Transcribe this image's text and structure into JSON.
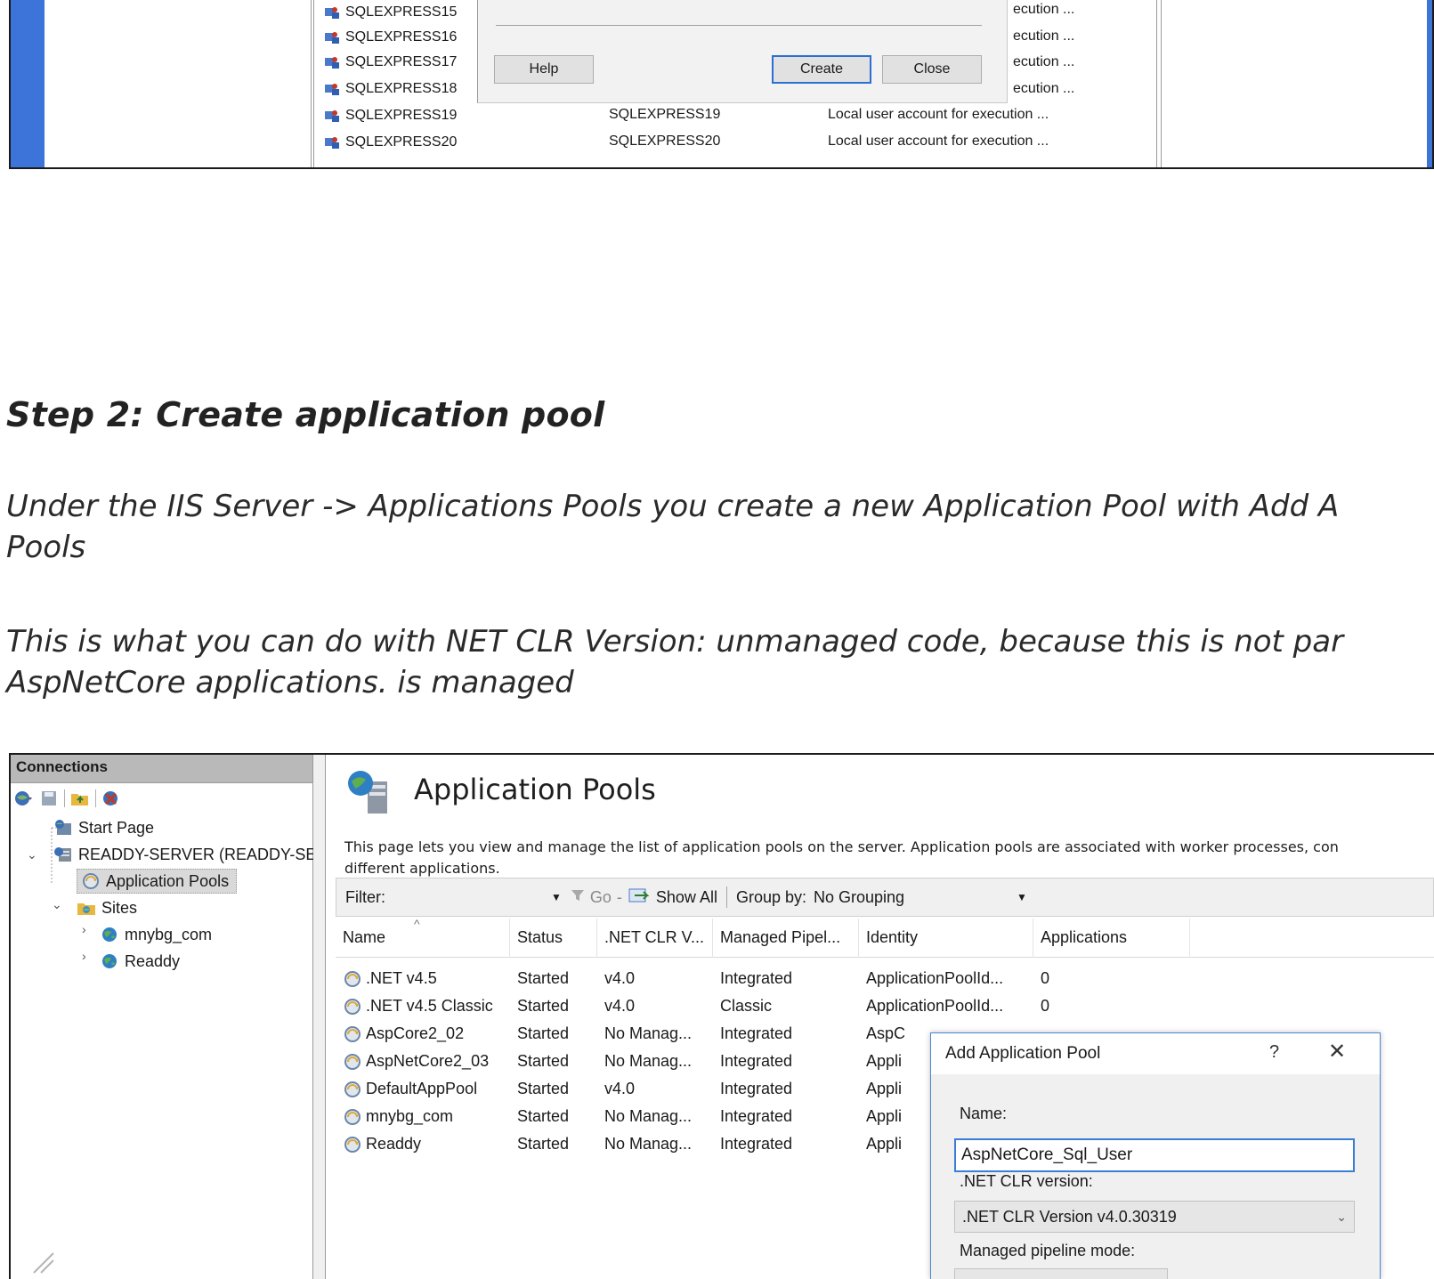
{
  "top_shot": {
    "rows": [
      {
        "name": "SQLEXPRESS15",
        "tail": "ecution ..."
      },
      {
        "name": "SQLEXPRESS16",
        "tail": "ecution ..."
      },
      {
        "name": "SQLEXPRESS17",
        "tail": "ecution ..."
      },
      {
        "name": "SQLEXPRESS18",
        "tail": "ecution ..."
      },
      {
        "name": "SQLEXPRESS19",
        "full_name": "SQLEXPRESS19",
        "description": "Local user account for execution ..."
      },
      {
        "name": "SQLEXPRESS20",
        "full_name": "SQLEXPRESS20",
        "description": "Local user account for execution ..."
      }
    ],
    "buttons": {
      "help": "Help",
      "create": "Create",
      "close": "Close"
    }
  },
  "article": {
    "heading": "Step 2: Create application pool",
    "para1_line1": "Under the IIS Server -> Applications Pools you create a new Application Pool with Add A",
    "para1_line2": "Pools",
    "para2_line1": "This is what you can do with NET CLR Version: unmanaged code, because this is not par",
    "para2_line2": "AspNetCore applications. is managed"
  },
  "iis": {
    "connections": {
      "title": "Connections",
      "tree": {
        "start_page": "Start Page",
        "server": "READDY-SERVER (READDY-SE",
        "app_pools": "Application Pools",
        "sites": "Sites",
        "site1": "mnybg_com",
        "site2": "Readdy"
      }
    },
    "page": {
      "title": "Application Pools",
      "desc_line1": "This page lets you view and manage the list of application pools on the server. Application pools are associated with worker processes, con",
      "desc_line2": "different applications."
    },
    "filter": {
      "label": "Filter:",
      "go": "Go",
      "show_all": "Show All",
      "group_by": "Group by:",
      "group_value": "No Grouping"
    },
    "columns": {
      "name": "Name",
      "status": "Status",
      "clr": ".NET CLR V...",
      "pipeline": "Managed Pipel...",
      "identity": "Identity",
      "applications": "Applications"
    },
    "pools": [
      {
        "name": ".NET v4.5",
        "status": "Started",
        "clr": "v4.0",
        "pipeline": "Integrated",
        "identity": "ApplicationPoolId...",
        "apps": "0"
      },
      {
        "name": ".NET v4.5 Classic",
        "status": "Started",
        "clr": "v4.0",
        "pipeline": "Classic",
        "identity": "ApplicationPoolId...",
        "apps": "0"
      },
      {
        "name": "AspCore2_02",
        "status": "Started",
        "clr": "No Manag...",
        "pipeline": "Integrated",
        "identity": "AspC",
        "apps": ""
      },
      {
        "name": "AspNetCore2_03",
        "status": "Started",
        "clr": "No Manag...",
        "pipeline": "Integrated",
        "identity": "Appli",
        "apps": ""
      },
      {
        "name": "DefaultAppPool",
        "status": "Started",
        "clr": "v4.0",
        "pipeline": "Integrated",
        "identity": "Appli",
        "apps": ""
      },
      {
        "name": "mnybg_com",
        "status": "Started",
        "clr": "No Manag...",
        "pipeline": "Integrated",
        "identity": "Appli",
        "apps": ""
      },
      {
        "name": "Readdy",
        "status": "Started",
        "clr": "No Manag...",
        "pipeline": "Integrated",
        "identity": "Appli",
        "apps": ""
      }
    ]
  },
  "dialog": {
    "title": "Add Application Pool",
    "help": "?",
    "close": "✕",
    "name_label": "Name:",
    "name_value": "AspNetCore_Sql_User",
    "clr_label": ".NET CLR version:",
    "clr_value": ".NET CLR Version v4.0.30319",
    "pipeline_label": "Managed pipeline mode:"
  },
  "colors": {
    "accent_blue": "#3c74d9",
    "focus_blue": "#3a7fd4",
    "header_gray": "#b9b9b9"
  }
}
